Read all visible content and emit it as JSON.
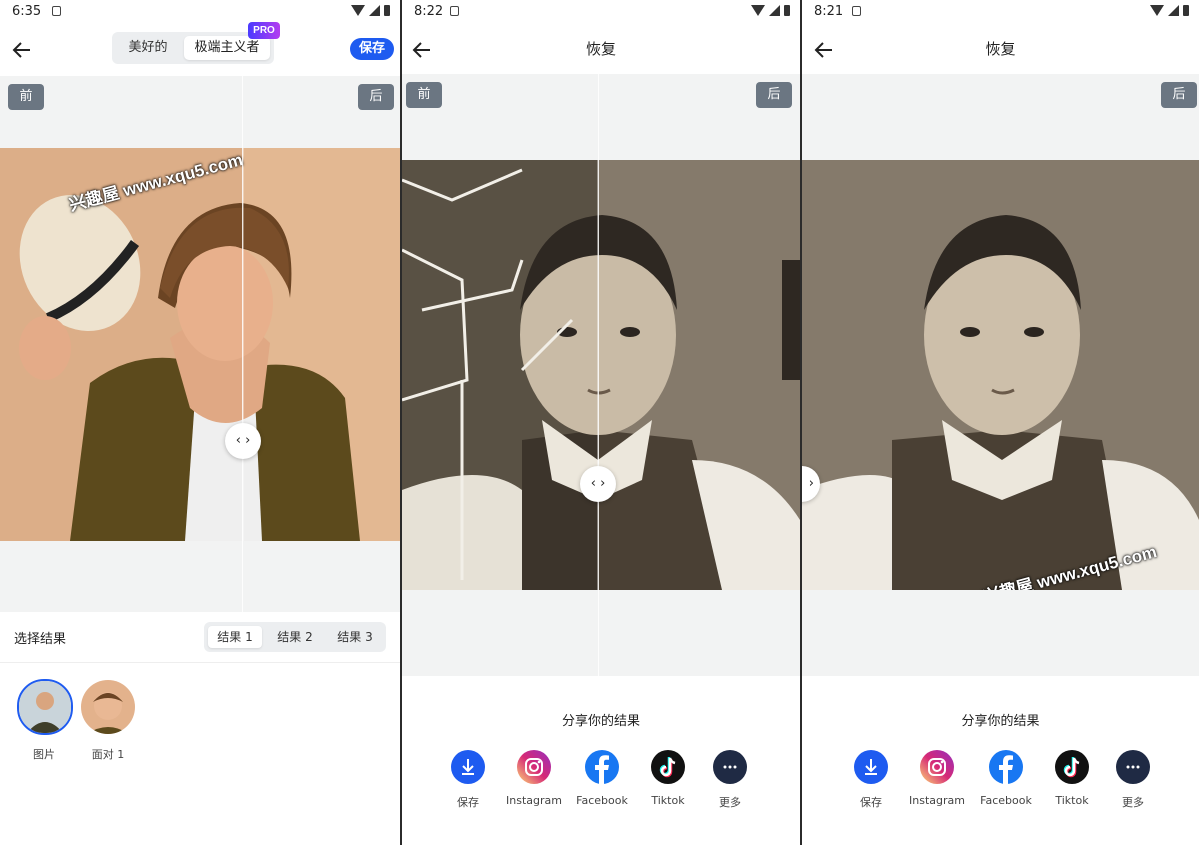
{
  "screens": [
    {
      "status_time": "6:35",
      "tabs": [
        "美好的",
        "极端主义者"
      ],
      "pro_badge": "PRO",
      "save_label": "保存",
      "before_label": "前",
      "after_label": "后",
      "watermark": "兴趣屋 www.xqu5.com",
      "handle_glyph": "‹ ›",
      "select_label": "选择结果",
      "results": [
        "结果 1",
        "结果 2",
        "结果 3"
      ],
      "thumbnails": [
        "图片",
        "面对 1"
      ]
    },
    {
      "status_time": "8:22",
      "title": "恢复",
      "before_label": "前",
      "after_label": "后",
      "handle_glyph": "‹ ›",
      "share_title": "分享你的结果",
      "share_items": [
        "保存",
        "Instagram",
        "Facebook",
        "Tiktok",
        "更多"
      ]
    },
    {
      "status_time": "8:21",
      "title": "恢复",
      "after_label": "后",
      "handle_glyph": "›",
      "watermark": "兴趣屋 www.xqu5.com",
      "share_title": "分享你的结果",
      "share_items": [
        "保存",
        "Instagram",
        "Facebook",
        "Tiktok",
        "更多"
      ]
    }
  ],
  "colors": {
    "accent": "#1e5bf0",
    "instagram": "#e1306c",
    "facebook": "#1877f2",
    "tiktok": "#111111",
    "more": "#1f2a44"
  }
}
